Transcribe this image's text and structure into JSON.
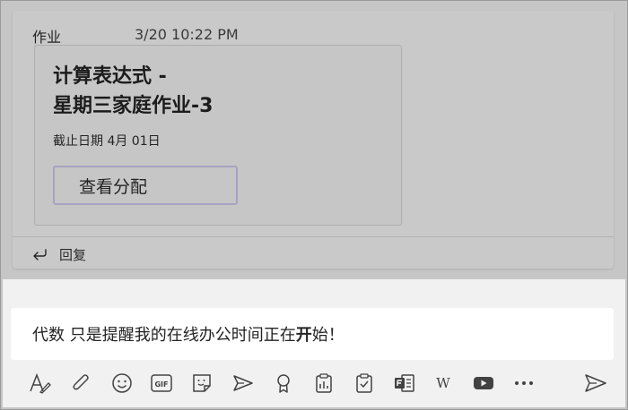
{
  "message": {
    "author": "作业",
    "timestamp": "3/20 10:22 PM",
    "card": {
      "title_line1": "计算表达式 -",
      "title_line2": "星期三家庭作业-3",
      "due": "截止日期 4月 01日",
      "button_label": "查看分配"
    },
    "reply_label": "回复"
  },
  "compose": {
    "text_before": "代数 只是提醒我的在线办公时间正在",
    "text_bold": "开",
    "text_after": "始！"
  },
  "toolbar": {
    "icons": [
      "format-icon",
      "attach-icon",
      "emoji-icon",
      "gif-icon",
      "sticker-icon",
      "meet-icon",
      "praise-icon",
      "insights-icon",
      "assignments-icon",
      "forms-icon",
      "wikipedia-icon",
      "youtube-icon",
      "more-options-icon",
      "send-icon"
    ],
    "gif_label": "GIF",
    "wiki_label": "W"
  }
}
